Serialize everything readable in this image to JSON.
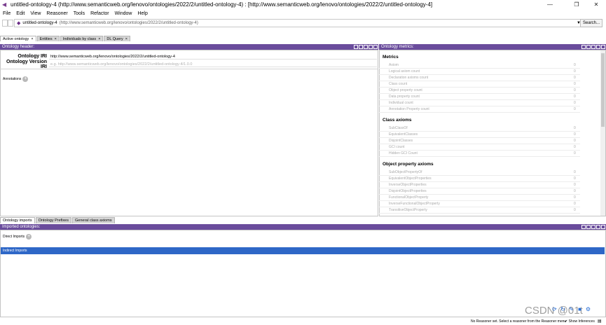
{
  "window": {
    "title": "untitled-ontology-4 (http://www.semanticweb.org/lenovo/ontologies/2022/2/untitled-ontology-4) : [http://www.semanticweb.org/lenovo/ontologies/2022/2/untitled-ontology-4]",
    "minimize": "—",
    "maximize": "❐",
    "close": "✕"
  },
  "menu": [
    "File",
    "Edit",
    "View",
    "Reasoner",
    "Tools",
    "Refactor",
    "Window",
    "Help"
  ],
  "address": {
    "ontology": "untitled-ontology-4",
    "iri": "(http://www.semanticweb.org/lenovo/ontologies/2022/2/untitled-ontology-4)",
    "search_label": "Search..."
  },
  "tabs": [
    "Active ontology",
    "Entities",
    "Individuals by class",
    "DL Query"
  ],
  "header_view": {
    "title": "Ontology header:",
    "iri_label": "Ontology IRI",
    "iri_value": "http://www.semanticweb.org/lenovo/ontologies/2022/2/untitled-ontology-4",
    "version_label": "Ontology Version IRI",
    "version_placeholder": "e.g. http://www.semanticweb.org/lenovo/ontologies/2022/2/untitled-ontology-4/1.0.0",
    "annotations_label": "Annotations"
  },
  "metrics_view": {
    "title": "Ontology metrics:",
    "sections": [
      {
        "heading": "Metrics",
        "rows": [
          {
            "label": "Axiom",
            "value": "0"
          },
          {
            "label": "Logical axiom count",
            "value": "0"
          },
          {
            "label": "Declaration axioms count",
            "value": "0"
          },
          {
            "label": "Class count",
            "value": "0"
          },
          {
            "label": "Object property count",
            "value": "0"
          },
          {
            "label": "Data property count",
            "value": "0"
          },
          {
            "label": "Individual count",
            "value": "0"
          },
          {
            "label": "Annotation Property count",
            "value": "0"
          }
        ]
      },
      {
        "heading": "Class axioms",
        "rows": [
          {
            "label": "SubClassOf",
            "value": "0"
          },
          {
            "label": "EquivalentClasses",
            "value": "0"
          },
          {
            "label": "DisjointClasses",
            "value": "0"
          },
          {
            "label": "GCI count",
            "value": "0"
          },
          {
            "label": "Hidden GCI Count",
            "value": "0"
          }
        ]
      },
      {
        "heading": "Object property axioms",
        "rows": [
          {
            "label": "SubObjectPropertyOf",
            "value": "0"
          },
          {
            "label": "EquivalentObjectProperties",
            "value": "0"
          },
          {
            "label": "InverseObjectProperties",
            "value": "0"
          },
          {
            "label": "DisjointObjectProperties",
            "value": "0"
          },
          {
            "label": "FunctionalObjectProperty",
            "value": "0"
          },
          {
            "label": "InverseFunctionalObjectProperty",
            "value": "0"
          },
          {
            "label": "TransitiveObjectProperty",
            "value": "0"
          }
        ]
      }
    ]
  },
  "bottom_tabs": [
    "Ontology imports",
    "Ontology Prefixes",
    "General class axioms"
  ],
  "imports_view": {
    "title": "Imported ontologies:",
    "direct_label": "Direct Imports",
    "indirect_label": "Indirect Imports"
  },
  "status": {
    "reasoner": "No Reasoner set. Select a reasoner from the Reasoner menu",
    "show_inferences": "Show Inferences"
  },
  "watermark": "CSDN @01t",
  "colors": {
    "view_header": "#6a4c9c",
    "selection": "#2e67c7"
  }
}
